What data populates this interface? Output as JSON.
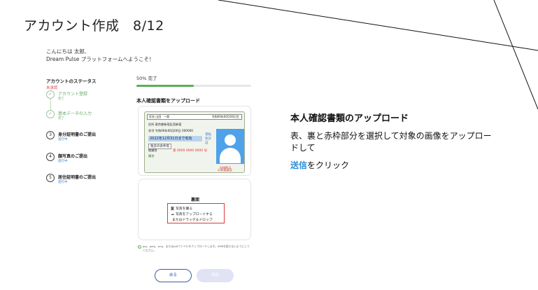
{
  "slide_title": "アカウント作成　8/12",
  "greeting": {
    "line1": "こんにちは 太郎,",
    "line2": "Dream Pulse プラットフォームへようこそ！"
  },
  "status": {
    "title": "アカウントのステータス",
    "subtitle": "未承認",
    "steps": [
      {
        "number": "✓",
        "label": "アカウント登録",
        "state": "完了"
      },
      {
        "number": "✓",
        "label": "基本データの入力",
        "state": "完了"
      },
      {
        "number": "3",
        "label": "身分証明書のご提出",
        "state": "進行中"
      },
      {
        "number": "4",
        "label": "顔写真のご提出",
        "state": "進行中"
      },
      {
        "number": "5",
        "label": "居住証明書のご提出",
        "state": "進行中"
      }
    ]
  },
  "progress": {
    "label": "50% 完了",
    "percent": 50
  },
  "document": {
    "title": "本人確認書類をアップロード",
    "license": {
      "name_line": "氏名 山田　一郎",
      "birth": "令和00年00月00日生",
      "address": "住所 東京都新宿区西新宿",
      "issue": "交付 令和00年00月00日 000000",
      "expiry": "2022年12月31日まで有効",
      "cond_label": "免許の条件等",
      "cond_value": "眼鏡等",
      "sticker": "優良",
      "number": "第 0000 0000 0000 号",
      "vertical": "運転免許証",
      "sample": "SAMPLE",
      "authority": "公安委員会"
    },
    "upload": {
      "label": "裏面",
      "take_photo": "写真を撮る",
      "upload_photo": "写真をアップロードする",
      "drag_drop": "またはドラッグ＆ドロップ"
    },
    "note": "jpg、jpeg、png、またはpdfファイルをアップロードします。5MBを超えないようにしてください。"
  },
  "buttons": {
    "back": "戻る",
    "send": "送信"
  },
  "instruction": {
    "title": "本人確認書類のアップロード",
    "body": "表、裏と赤枠部分を選択して対象の画像をアップロードして",
    "action_highlight": "送信",
    "action_rest": "をクリック"
  },
  "colors": {
    "accent_green": "#5cae5a",
    "highlight_blue": "#2f8fd8",
    "button_blue": "#3d5ca8",
    "upload_border_red": "#d93a3a"
  }
}
